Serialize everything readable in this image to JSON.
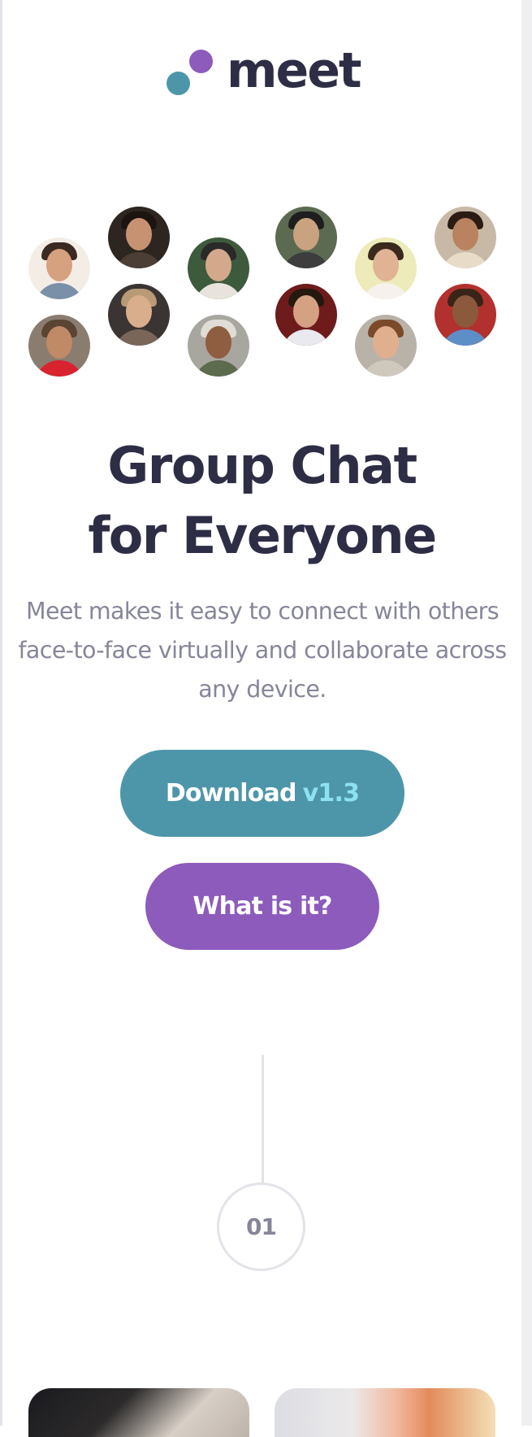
{
  "logo": {
    "text": "meet",
    "accent_teal": "#4d96a9",
    "accent_purple": "#8d5bbc"
  },
  "avatars": [
    {
      "name": "avatar-1"
    },
    {
      "name": "avatar-2"
    },
    {
      "name": "avatar-3"
    },
    {
      "name": "avatar-4"
    },
    {
      "name": "avatar-5"
    },
    {
      "name": "avatar-6"
    },
    {
      "name": "avatar-7"
    },
    {
      "name": "avatar-8"
    },
    {
      "name": "avatar-9"
    },
    {
      "name": "avatar-10"
    },
    {
      "name": "avatar-11"
    },
    {
      "name": "avatar-12"
    }
  ],
  "hero": {
    "title_line1": "Group Chat",
    "title_line2": "for Everyone",
    "description": "Meet makes it easy to connect with others face-to-face virtually and collaborate across any device."
  },
  "buttons": {
    "download_label": "Download",
    "download_version": "v1.3",
    "what_label": "What is it?"
  },
  "step": {
    "number": "01"
  },
  "colors": {
    "heading": "#2d2e45",
    "body": "#86869a",
    "download_bg": "#4d96a9",
    "version": "#8ee1ef",
    "what_bg": "#8d5bbc",
    "divider": "#e3e3e9"
  }
}
